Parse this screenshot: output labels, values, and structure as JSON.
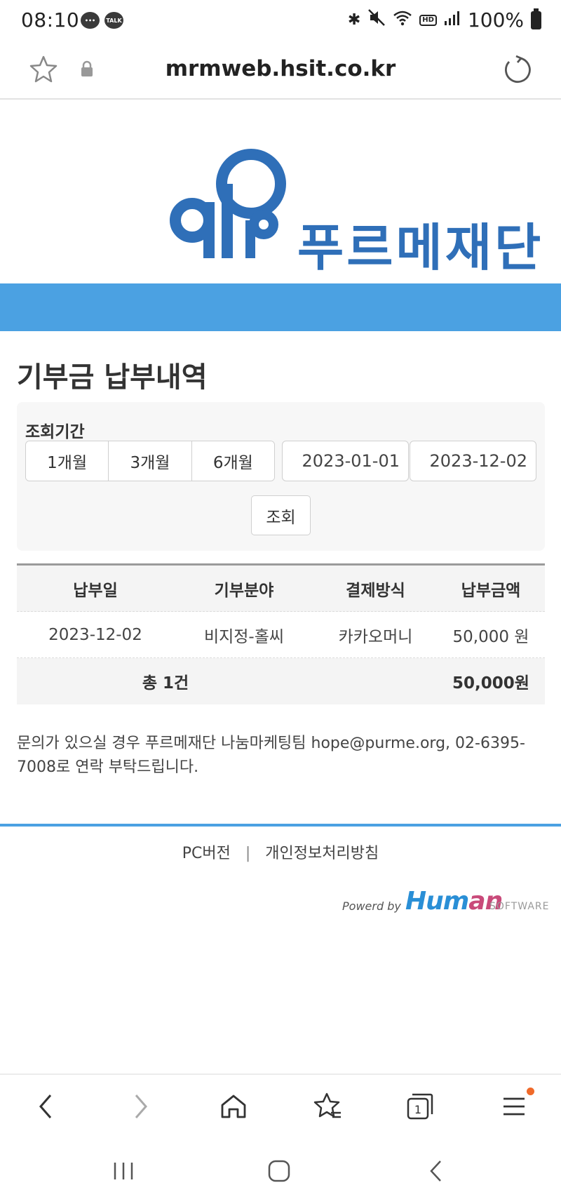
{
  "status_bar": {
    "time": "08:10",
    "talk_badge": "TALK",
    "hd_badge": "HD",
    "battery": "100%"
  },
  "url_bar": {
    "url": "mrmweb.hsit.co.kr"
  },
  "logo": {
    "org_name": "푸르메재단"
  },
  "page": {
    "title": "기부금 납부내역"
  },
  "search": {
    "label": "조회기간",
    "periods": [
      "1개월",
      "3개월",
      "6개월"
    ],
    "start_date": "2023-01-01",
    "end_date": "2023-12-02",
    "search_label": "조회"
  },
  "table": {
    "headers": [
      "납부일",
      "기부분야",
      "결제방식",
      "납부금액"
    ],
    "rows": [
      [
        "2023-12-02",
        "비지정-홀씨",
        "카카오머니",
        "50,000 원"
      ]
    ],
    "total_label": "총 1건",
    "total_amount": "50,000원"
  },
  "notice": "문의가 있으실 경우 푸르메재단 나눔마케팅팀 hope@purme.org, 02-6395-7008로 연락 부탁드립니다.",
  "footer": {
    "pc_version": "PC버전",
    "separator": "|",
    "privacy": "개인정보처리방침",
    "powered_by": "Powerd by",
    "brand_part1": "Hum",
    "brand_part2": "an",
    "software": "SOFTWARE"
  },
  "colors": {
    "accent_blue": "#4ba1e2",
    "logo_blue": "#2f6fb8",
    "notification_dot": "#f06a2a"
  }
}
